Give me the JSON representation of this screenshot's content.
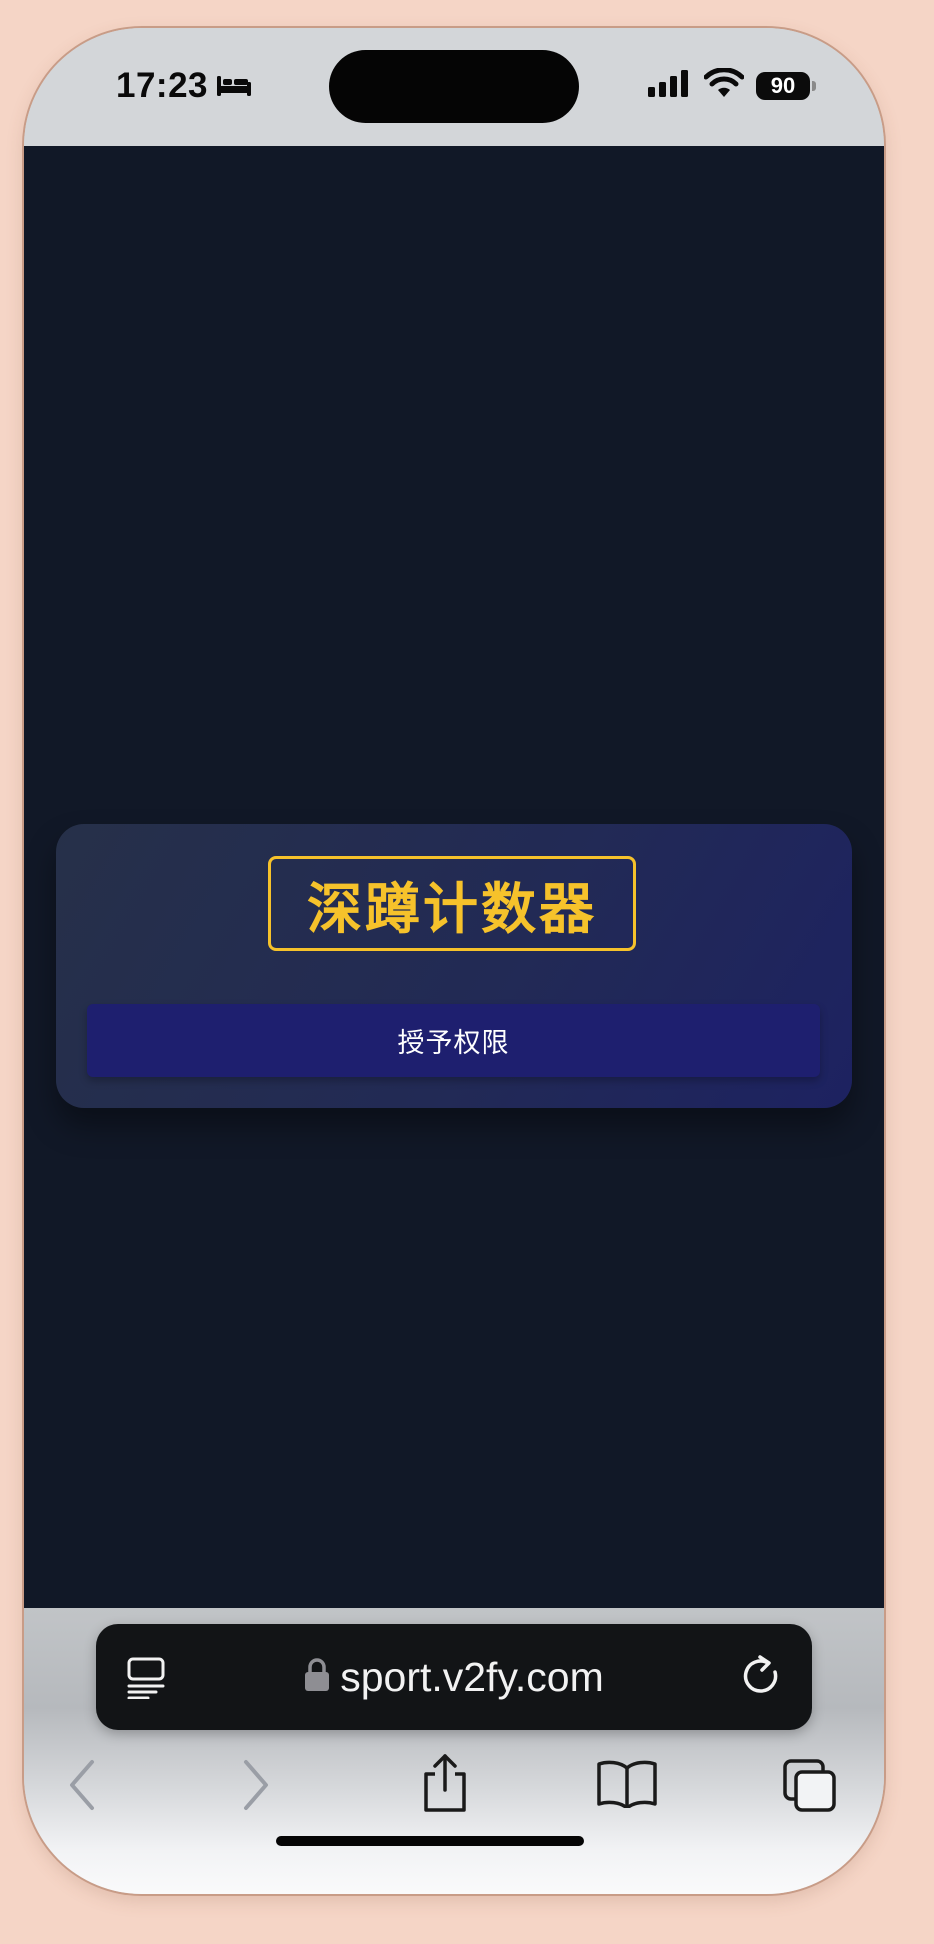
{
  "status_bar": {
    "time": "17:23",
    "battery": "90",
    "icons": [
      "bed-icon",
      "signal-icon",
      "wifi-icon",
      "battery-icon"
    ]
  },
  "app": {
    "title": "深蹲计数器",
    "grant_button_label": "授予权限"
  },
  "browser": {
    "url": "sport.v2fy.com",
    "icons": [
      "reader-icon",
      "lock-icon",
      "reload-icon",
      "back-icon",
      "forward-icon",
      "share-icon",
      "bookmarks-icon",
      "tabs-icon"
    ]
  },
  "colors": {
    "page_background": "#111827",
    "card_gradient_start": "#263049",
    "card_gradient_end": "#1d2261",
    "title_accent": "#f6c22b",
    "button_background": "#1e1f6f"
  }
}
